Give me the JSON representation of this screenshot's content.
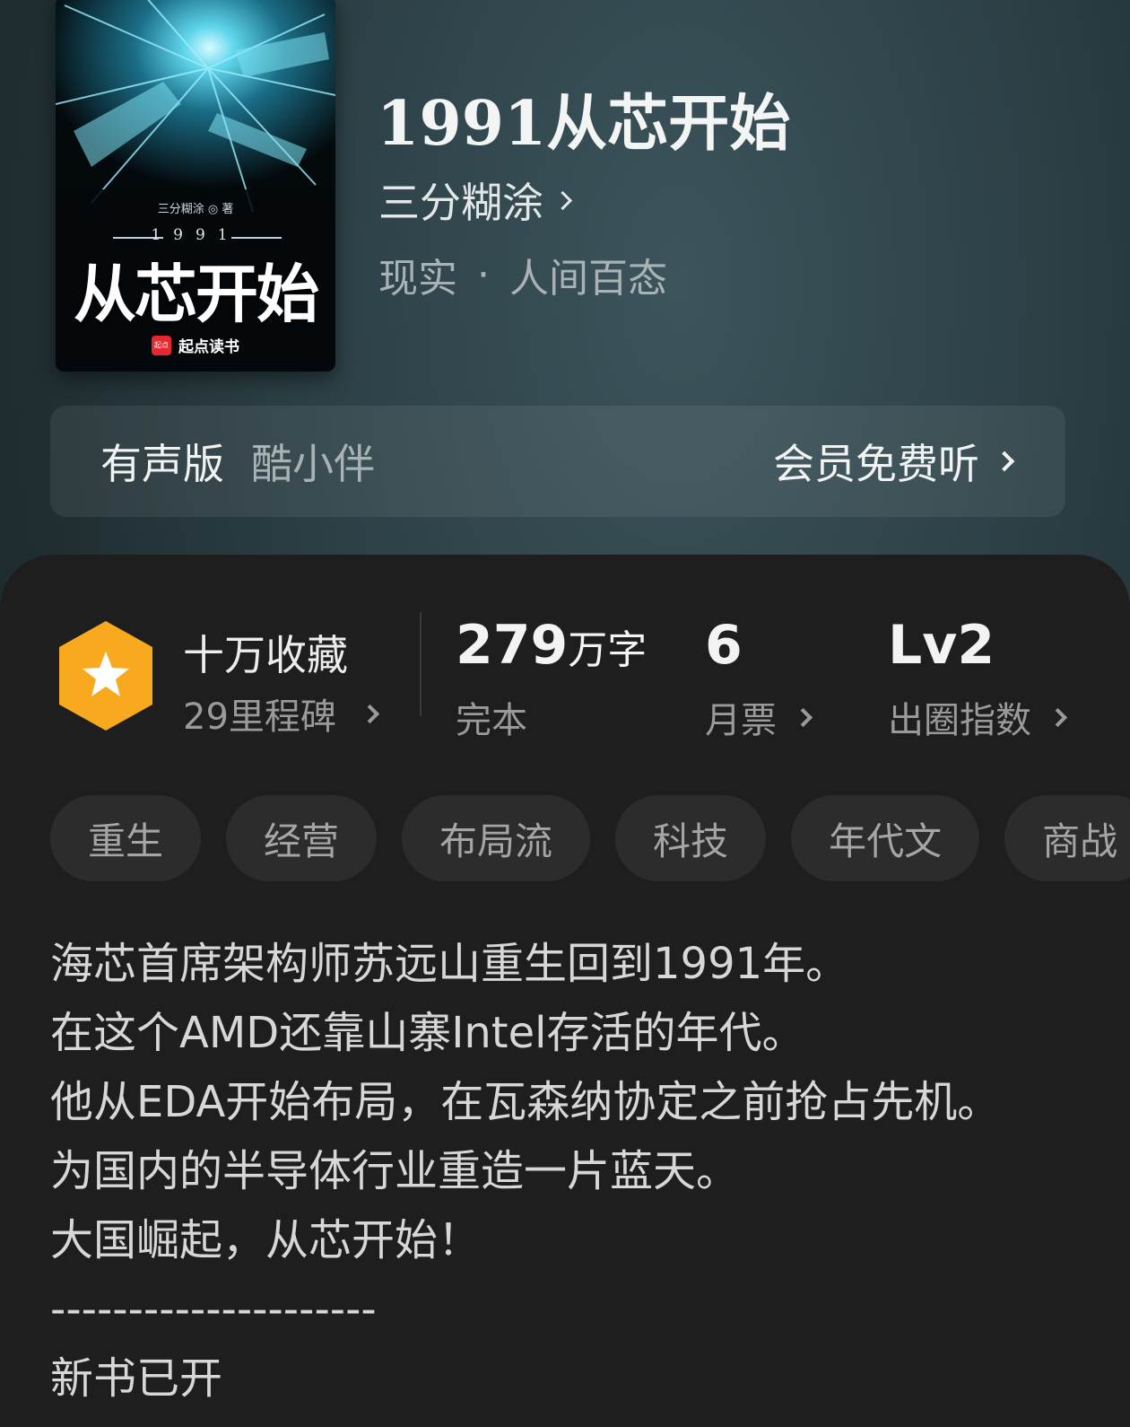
{
  "book": {
    "title": "1991从芯开始",
    "author": "三分糊涂",
    "category": "现实",
    "subcategory": "人间百态",
    "separator": "·"
  },
  "cover": {
    "author_line": "三分糊涂 ◎ 著",
    "year": "1991",
    "title": "从芯开始",
    "publisher_logo": "起点",
    "publisher": "起点读书"
  },
  "audio": {
    "label": "有声版",
    "voice": "酷小伴",
    "action": "会员免费听"
  },
  "stats": {
    "favorites": "十万收藏",
    "milestones": "29里程碑",
    "word_count": "279",
    "word_unit": "万字",
    "status": "完本",
    "monthly_votes": "6",
    "monthly_votes_label": "月票",
    "influence_level": "Lv2",
    "influence_label": "出圈指数"
  },
  "tags": [
    "重生",
    "经营",
    "布局流",
    "科技",
    "年代文",
    "商战"
  ],
  "description": [
    "海芯首席架构师苏远山重生回到1991年。",
    "在这个AMD还靠山寨Intel存活的年代。",
    "他从EDA开始布局，在瓦森纳协定之前抢占先机。",
    "为国内的半导体行业重造一片蓝天。",
    "大国崛起，从芯开始！",
    "---------------------",
    "新书已开"
  ],
  "colors": {
    "badge": "#f9a91e",
    "panel": "#1e1e1e",
    "tag_bg": "#2c2c2c"
  }
}
